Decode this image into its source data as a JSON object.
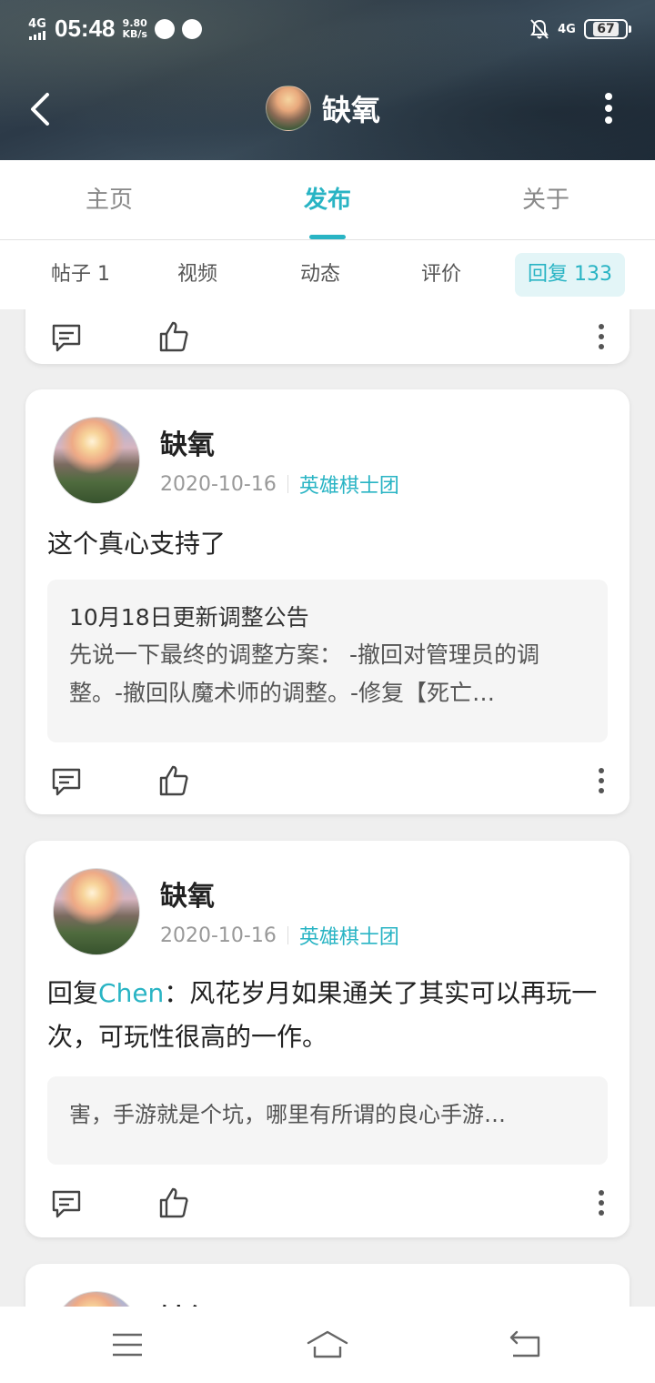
{
  "status_bar": {
    "network": "4G",
    "time": "05:48",
    "speed_value": "9.80",
    "speed_unit": "KB/s",
    "network_right": "4G",
    "battery": "67"
  },
  "nav": {
    "title": "缺氧"
  },
  "main_tabs": [
    {
      "label": "主页",
      "active": false
    },
    {
      "label": "发布",
      "active": true
    },
    {
      "label": "关于",
      "active": false
    }
  ],
  "sub_tabs": [
    {
      "label": "帖子 1"
    },
    {
      "label": "视频"
    },
    {
      "label": "动态"
    },
    {
      "label": "评价"
    },
    {
      "label": "回复 133",
      "active": true
    }
  ],
  "posts": [
    {
      "author": "缺氧",
      "date": "2020-10-16",
      "group": "英雄棋士团",
      "text": "这个真心支持了",
      "quote_title": "10月18日更新调整公告",
      "quote_body": "先说一下最终的调整方案： -撤回对管理员的调整。-撤回队魔术师的调整。-修复【死亡…"
    },
    {
      "author": "缺氧",
      "date": "2020-10-16",
      "group": "英雄棋士团",
      "reply_prefix": "回复",
      "reply_to": "Chen",
      "text": "：风花岁月如果通关了其实可以再玩一次，可玩性很高的一作。",
      "quote_body": "害，手游就是个坑，哪里有所谓的良心手游…"
    },
    {
      "author": "缺氧"
    }
  ],
  "icons": {
    "back": "chevron-left-icon",
    "more": "more-vertical-icon",
    "comment": "comment-icon",
    "like": "thumbs-up-icon",
    "menu": "menu-icon",
    "home": "home-icon",
    "return": "return-icon"
  },
  "colors": {
    "accent": "#29b4c4",
    "background": "#efefef"
  }
}
